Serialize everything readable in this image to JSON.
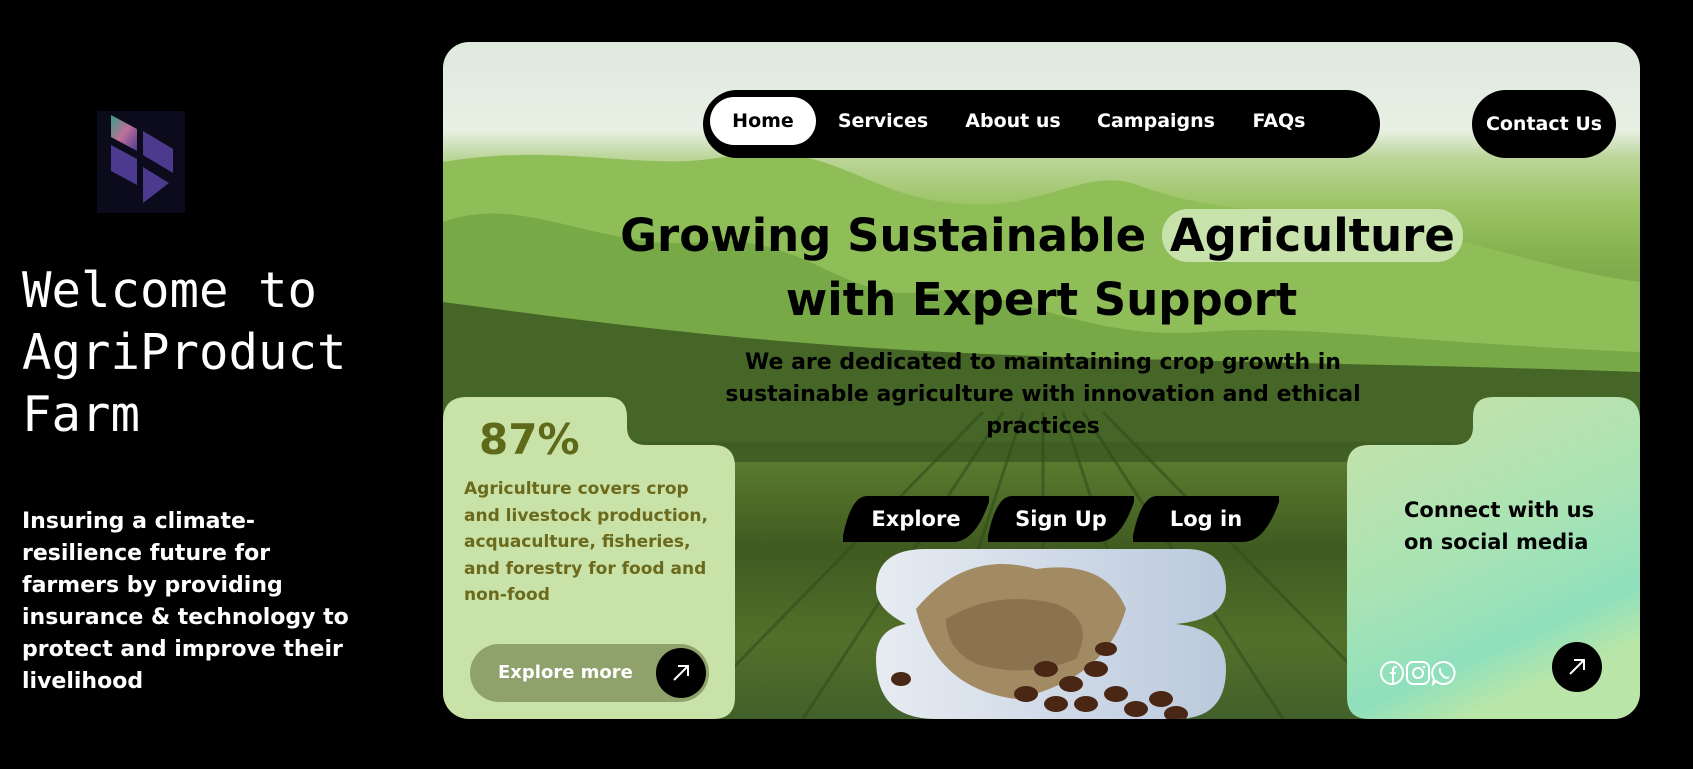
{
  "sidebar": {
    "heading": "Welcome to\nAgriProduct\nFarm",
    "tagline": "Insuring a climate-resilience future for farmers by providing insurance & technology to protect and improve their livelihood"
  },
  "nav": {
    "items": [
      "Home",
      "Services",
      "About us",
      "Campaigns",
      "FAQs"
    ],
    "active": "Home",
    "contact": "Contact Us"
  },
  "hero": {
    "headline_part1": "Growing Sustainable ",
    "headline_highlight": "Agriculture",
    "headline_line2": "with Expert Support",
    "subtitle": "We are dedicated to maintaining crop growth in sustainable agriculture with innovation and ethical practices"
  },
  "stat_card": {
    "value": "87%",
    "text": "Agriculture covers crop and livestock production, acquaculture, fisheries, and forestry for food and non-food",
    "button": "Explore more"
  },
  "cta_buttons": [
    "Explore",
    "Sign Up",
    "Log in"
  ],
  "social_card": {
    "title": "Connect with us on social media",
    "icons": [
      "facebook-icon",
      "instagram-icon",
      "whatsapp-icon"
    ]
  },
  "colors": {
    "background": "#000000",
    "highlight": "#c8e2ac",
    "card_green": "#c9e2a8",
    "social_gradient_end": "#8fe0bc",
    "logo_purple": "#4b3a8e"
  }
}
